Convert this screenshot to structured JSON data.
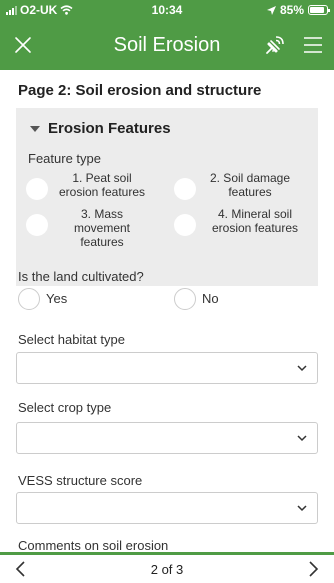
{
  "status_bar": {
    "carrier": "O2-UK",
    "time": "10:34",
    "battery": "85%",
    "icons": [
      "signal-icon",
      "wifi-icon",
      "location-arrow-icon",
      "battery-icon"
    ]
  },
  "header": {
    "title": "Soil Erosion",
    "icons": [
      "close-icon",
      "gps-satellite-icon",
      "hamburger-menu-icon"
    ]
  },
  "main": {
    "page_heading": "Page 2: Soil erosion and structure",
    "erosion_group": {
      "title": "Erosion Features",
      "feature_type_label": "Feature type",
      "options": [
        "1. Peat soil erosion features",
        "2. Soil damage features",
        "3. Mass movement features",
        "4. Mineral soil erosion features"
      ]
    },
    "cultivated": {
      "label": "Is the land cultivated?",
      "options": [
        "Yes",
        "No"
      ]
    },
    "habitat": {
      "label": "Select habitat type",
      "value": ""
    },
    "crop": {
      "label": "Select crop type",
      "value": ""
    },
    "vess": {
      "label": "VESS structure score",
      "value": ""
    },
    "cutoff_label": "Comments on soil erosion"
  },
  "footer": {
    "page_count": "2 of 3",
    "icons": [
      "chevron-left-icon",
      "chevron-right-icon"
    ]
  },
  "colors": {
    "brand_green": "#4f9b45",
    "group_background": "#ececec"
  }
}
